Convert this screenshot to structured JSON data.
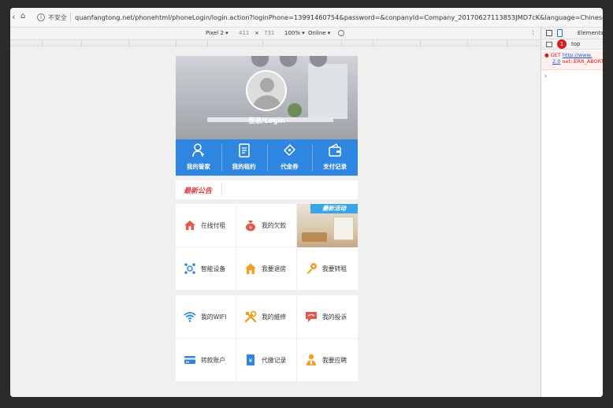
{
  "browser": {
    "nav_back": "‹",
    "nav_forward": "›",
    "nav_reload": "C",
    "nav_home": "⌂",
    "insecure_label": "不安全",
    "url": "quanfangtong.net/phonehtml/phoneLogin/login.action?loginPhone=13991460754&password=&conpanyId=Company_20170627113853JMD7cK&language=Chinese"
  },
  "device_toolbar": {
    "device": "Pixel 2 ▾",
    "width": "411",
    "times": "×",
    "height": "731",
    "zoom": "100% ▾",
    "network": "Online ▾",
    "more": "⋮"
  },
  "devtools": {
    "elements_tab": "Elements",
    "error_count": "1",
    "context": "top",
    "error_line1_prefix": "● GET ",
    "error_line1_link": "http://www.",
    "error_line2_link": "2.0",
    "error_line2_text": " net::ERR_ABORTED",
    "prompt": "›"
  },
  "app": {
    "login_label": "登录/Login",
    "quick_actions": [
      {
        "label": "我的管家",
        "icon": "person-icon"
      },
      {
        "label": "我的租约",
        "icon": "document-icon"
      },
      {
        "label": "代金券",
        "icon": "coupon-icon"
      },
      {
        "label": "支付记录",
        "icon": "wallet-icon"
      }
    ],
    "notice_tag": "最新公告",
    "promo_tag": "最新活动",
    "grid1": [
      {
        "label": "在线付租",
        "icon": "house-icon",
        "color": "#e8574d"
      },
      {
        "label": "我的欠款",
        "icon": "money-bag-icon",
        "color": "#e8574d"
      },
      {
        "label": "智能设备",
        "icon": "molecule-icon",
        "color": "#2f86e0"
      },
      {
        "label": "我要退房",
        "icon": "home-icon",
        "color": "#f0a020"
      },
      {
        "label": "我要转租",
        "icon": "key-icon",
        "color": "#f0a020"
      }
    ],
    "grid2": [
      {
        "label": "我的WIFI",
        "icon": "wifi-icon",
        "color": "#2f86e0"
      },
      {
        "label": "我的維修",
        "icon": "tools-icon",
        "color": "#f0a020"
      },
      {
        "label": "我的投诉",
        "icon": "chat-icon",
        "color": "#e8574d"
      },
      {
        "label": "转款账户",
        "icon": "card-icon",
        "color": "#2f86e0"
      },
      {
        "label": "代缴记录",
        "icon": "receipt-icon",
        "color": "#2f86e0"
      },
      {
        "label": "我要应聘",
        "icon": "user-tie-icon",
        "color": "#f0a020"
      }
    ]
  }
}
